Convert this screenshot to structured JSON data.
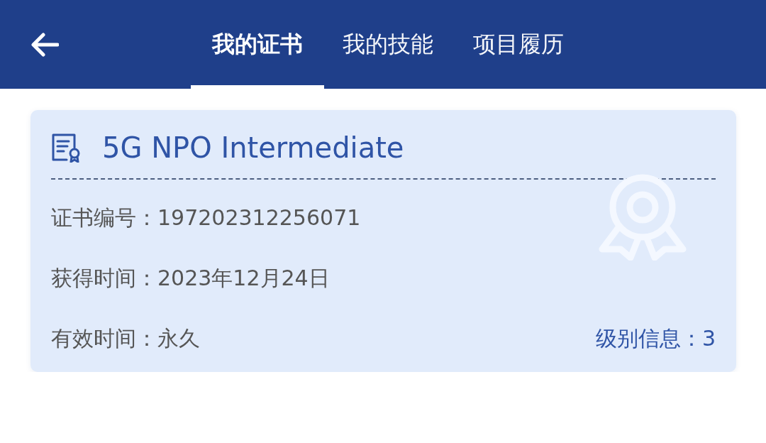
{
  "header": {
    "tabs": [
      {
        "label": "我的证书",
        "selected": true
      },
      {
        "label": "我的技能",
        "selected": false
      },
      {
        "label": "项目履历",
        "selected": false
      }
    ]
  },
  "certificate": {
    "title": "5G NPO Intermediate",
    "fields": [
      {
        "label": "证书编号：",
        "value": "197202312256071"
      },
      {
        "label": "获得时间：",
        "value": "2023年12月24日"
      },
      {
        "label": "有效时间：",
        "value": "永久"
      }
    ],
    "level_info": "级别信息：3"
  }
}
